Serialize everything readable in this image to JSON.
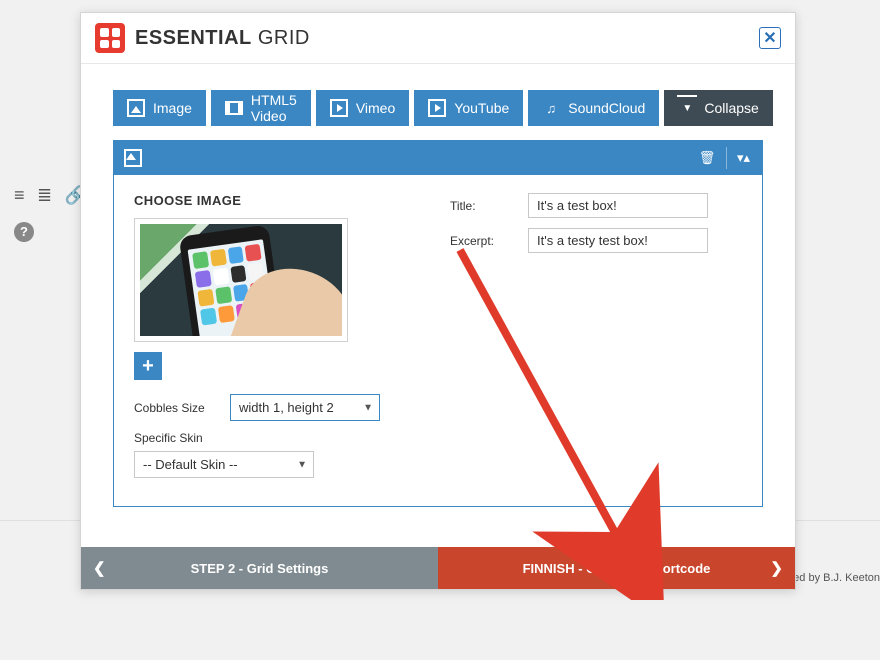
{
  "brand": {
    "strong": "ESSENTIAL",
    "light": "GRID"
  },
  "tabs": {
    "image": "Image",
    "html5": "HTML5 Video",
    "vimeo": "Vimeo",
    "youtube": "YouTube",
    "soundcloud": "SoundCloud",
    "collapse": "Collapse"
  },
  "panel": {
    "choose_image": "CHOOSE IMAGE",
    "cobbles_label": "Cobbles Size",
    "cobbles_value": "width 1, height 2",
    "skin_label": "Specific Skin",
    "skin_value": "-- Default Skin --",
    "title_label": "Title:",
    "title_value": "It's a test box!",
    "excerpt_label": "Excerpt:",
    "excerpt_value": "It's a testy test box!"
  },
  "footer": {
    "prev": "STEP 2 - Grid Settings",
    "next": "FINNISH - Generate Shortcode"
  },
  "bg": {
    "credit": "ed by B.J. Keeton"
  }
}
